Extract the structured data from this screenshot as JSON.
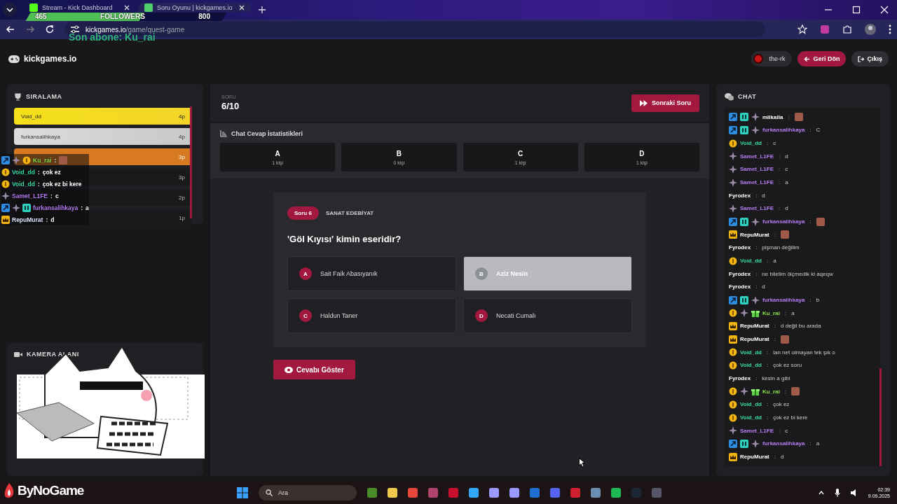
{
  "browser": {
    "tabs": [
      {
        "title": "Stream - Kick Dashboard",
        "selected": false
      },
      {
        "title": "Soru Oyunu | kickgames.io",
        "selected": true
      }
    ],
    "url": "**kickgames.io**/game/quest-game"
  },
  "header": {
    "logo": "kickgames.io",
    "user": "the-rk",
    "buttons": [
      {
        "kind": "back",
        "label": "Geri Dön"
      },
      {
        "kind": "logout",
        "label": "Çıkış"
      }
    ]
  },
  "leaderboard": {
    "title": "SIRALAMA",
    "rows": [
      {
        "name": "Void_dd",
        "points": "4p",
        "kind": "gold"
      },
      {
        "name": "furkansalihkaya",
        "points": "4p",
        "kind": "silver"
      },
      {
        "points": "3p",
        "kind": "bronze"
      },
      {
        "points": "3p",
        "kind": "plain"
      },
      {
        "points": "2p",
        "kind": "plain"
      },
      {
        "points": "1p",
        "kind": "plain"
      }
    ]
  },
  "camera": {
    "title": "KAMERA ALANI"
  },
  "quiz": {
    "label": "SORU",
    "progress": "6/10",
    "next_button": "Sonraki Soru",
    "stats": {
      "title": "Chat Cevap İstatistikleri",
      "options": [
        {
          "letter": "A",
          "count": "1 kişi"
        },
        {
          "letter": "B",
          "count": "0 kişi"
        },
        {
          "letter": "C",
          "count": "1 kişi"
        },
        {
          "letter": "D",
          "count": "1 kişi"
        }
      ]
    },
    "question": {
      "number": "Soru 6",
      "category": "SANAT EDEBİYAT",
      "text": "'Göl Kıyısı' kimin eseridir?",
      "answers": [
        {
          "letter": "A",
          "text": "Sait Faik Abasıyanık",
          "selected": false
        },
        {
          "letter": "B",
          "text": "Aziz Nesin",
          "selected": true
        },
        {
          "letter": "C",
          "text": "Haldun Taner",
          "selected": false
        },
        {
          "letter": "D",
          "text": "Necati Cumalı",
          "selected": false
        }
      ]
    },
    "reveal_button": "Cevabı Göster"
  },
  "chat": {
    "title": "CHAT",
    "separator": ":",
    "messages": [
      {
        "user": "milkaila",
        "color": "#ffffff",
        "badges": [
          {
            "kind": "boost"
          },
          {
            "kind": "sub"
          },
          {
            "kind": "sparkle"
          }
        ],
        "kind": "emote"
      },
      {
        "user": "furkansalihkaya",
        "color": "#b57cf2",
        "badges": [
          {
            "kind": "boost"
          },
          {
            "kind": "sub"
          },
          {
            "kind": "sparkle"
          }
        ],
        "kind": "text",
        "text": "C"
      },
      {
        "user": "Void_dd",
        "color": "#35d8a4",
        "badges": [
          {
            "kind": "coin"
          }
        ],
        "kind": "text",
        "text": "c"
      },
      {
        "user": "Samet_L1FE",
        "color": "#b57cf2",
        "badges": [
          {
            "kind": "sparkle"
          }
        ],
        "kind": "text",
        "text": "d"
      },
      {
        "user": "Samet_L1FE",
        "color": "#b57cf2",
        "badges": [
          {
            "kind": "sparkle"
          }
        ],
        "kind": "text",
        "text": "c"
      },
      {
        "user": "Samet_L1FE",
        "color": "#b57cf2",
        "badges": [
          {
            "kind": "sparkle"
          }
        ],
        "kind": "text",
        "text": "a"
      },
      {
        "user": "Fyrodex",
        "color": "#ffffff",
        "kind": "text",
        "text": "d"
      },
      {
        "user": "Samet_L1FE",
        "color": "#b57cf2",
        "badges": [
          {
            "kind": "sparkle"
          }
        ],
        "kind": "text",
        "text": "d"
      },
      {
        "user": "furkansalihkaya",
        "color": "#b57cf2",
        "badges": [
          {
            "kind": "boost"
          },
          {
            "kind": "sub"
          },
          {
            "kind": "sparkle"
          }
        ],
        "kind": "emote"
      },
      {
        "user": "RepuMurat",
        "color": "#ffffff",
        "badges": [
          {
            "kind": "crown"
          }
        ],
        "kind": "emote"
      },
      {
        "user": "Fyrodex",
        "color": "#ffffff",
        "kind": "text",
        "text": "pişman değilim"
      },
      {
        "user": "Void_dd",
        "color": "#35d8a4",
        "badges": [
          {
            "kind": "coin"
          }
        ],
        "kind": "text",
        "text": "a"
      },
      {
        "user": "Fyrodex",
        "color": "#ffffff",
        "kind": "text",
        "text": "ne bilelim ölçmedik ki aqeqw"
      },
      {
        "user": "Fyrodex",
        "color": "#ffffff",
        "kind": "text",
        "text": "d"
      },
      {
        "user": "furkansalihkaya",
        "color": "#b57cf2",
        "badges": [
          {
            "kind": "boost"
          },
          {
            "kind": "sub"
          },
          {
            "kind": "sparkle"
          }
        ],
        "kind": "text",
        "text": "b"
      },
      {
        "user": "Ku_rai",
        "color": "#8fe24c",
        "badges": [
          {
            "kind": "coin"
          },
          {
            "kind": "sparkle"
          },
          {
            "kind": "gift"
          }
        ],
        "kind": "text",
        "text": "a"
      },
      {
        "user": "RepuMurat",
        "color": "#ffffff",
        "badges": [
          {
            "kind": "crown"
          }
        ],
        "kind": "text",
        "text": "d değil bu arada"
      },
      {
        "user": "RepuMurat",
        "color": "#ffffff",
        "badges": [
          {
            "kind": "crown"
          }
        ],
        "kind": "emote"
      },
      {
        "user": "Void_dd",
        "color": "#35d8a4",
        "badges": [
          {
            "kind": "coin"
          }
        ],
        "kind": "text",
        "text": "lan net olmayan tek şık o"
      },
      {
        "user": "Void_dd",
        "color": "#35d8a4",
        "badges": [
          {
            "kind": "coin"
          }
        ],
        "kind": "text",
        "text": "çok ez soru"
      },
      {
        "user": "Fyrodex",
        "color": "#ffffff",
        "kind": "text",
        "text": "kesin a gibi"
      },
      {
        "user": "Ku_rai",
        "color": "#8fe24c",
        "badges": [
          {
            "kind": "coin"
          },
          {
            "kind": "sparkle"
          },
          {
            "kind": "gift"
          }
        ],
        "kind": "emote"
      },
      {
        "user": "Void_dd",
        "color": "#35d8a4",
        "badges": [
          {
            "kind": "coin"
          }
        ],
        "kind": "text",
        "text": "çok ez"
      },
      {
        "user": "Void_dd",
        "color": "#35d8a4",
        "badges": [
          {
            "kind": "coin"
          }
        ],
        "kind": "text",
        "text": "çok ez bi kere"
      },
      {
        "user": "Samet_L1FE",
        "color": "#b57cf2",
        "badges": [
          {
            "kind": "sparkle"
          }
        ],
        "kind": "text",
        "text": "c"
      },
      {
        "user": "furkansalihkaya",
        "color": "#b57cf2",
        "badges": [
          {
            "kind": "boost"
          },
          {
            "kind": "sub"
          },
          {
            "kind": "sparkle"
          }
        ],
        "kind": "text",
        "text": "a"
      },
      {
        "user": "RepuMurat",
        "color": "#ffffff",
        "badges": [
          {
            "kind": "crown"
          }
        ],
        "kind": "text",
        "text": "d"
      }
    ]
  },
  "stream_overlay": {
    "chat_separator": ":",
    "followers": {
      "current": "465",
      "label": "FOLLOWERS",
      "goal": "800",
      "level": 0.58
    },
    "last_sub": "Son abone: Ku_rai",
    "brand": "ByNoGame",
    "chat": [
      {
        "user": "Ku_rai",
        "color": "#8fe24c",
        "badges": [
          {
            "kind": "boost"
          },
          {
            "kind": "sparkle"
          },
          {
            "kind": "coin"
          }
        ],
        "kind": "emote"
      },
      {
        "user": "Void_dd",
        "color": "#35d8a4",
        "badges": [
          {
            "kind": "coin"
          }
        ],
        "kind": "text",
        "text": "çok ez"
      },
      {
        "user": "Void_dd",
        "color": "#35d8a4",
        "badges": [
          {
            "kind": "coin"
          }
        ],
        "kind": "text",
        "text": "çok ez bi kere"
      },
      {
        "user": "Samet_L1FE",
        "color": "#b57cf2",
        "badges": [
          {
            "kind": "sparkle"
          }
        ],
        "kind": "text",
        "text": "c"
      },
      {
        "user": "furkansalihkaya",
        "color": "#b57cf2",
        "badges": [
          {
            "kind": "boost"
          },
          {
            "kind": "sparkle"
          },
          {
            "kind": "sub"
          }
        ],
        "kind": "text",
        "text": "a"
      },
      {
        "user": "RepuMurat",
        "color": "#dfe6ff",
        "badges": [
          {
            "kind": "crown"
          }
        ],
        "kind": "text",
        "text": "d"
      }
    ]
  },
  "taskbar": {
    "search_placeholder": "Ara",
    "time": "02:39",
    "date": "9.09.2025"
  }
}
